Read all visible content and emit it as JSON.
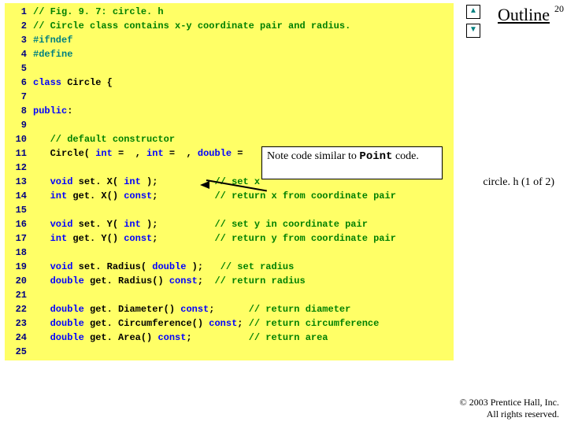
{
  "outline_label": "Outline",
  "page_number": "20",
  "scroll_up_glyph": "▲",
  "scroll_down_glyph": "▼",
  "caption": "circle. h (1 of 2)",
  "callout": {
    "pre": "Note code similar to ",
    "code": "Point",
    "post": " code."
  },
  "copyright": {
    "l1": "© 2003 Prentice Hall, Inc.",
    "l2": "All rights reserved."
  },
  "code": [
    {
      "n": "1",
      "segs": [
        [
          "cmt",
          "// Fig. 9. 7: circle. h"
        ]
      ]
    },
    {
      "n": "2",
      "segs": [
        [
          "cmt",
          "// Circle class contains x-y coordinate pair and radius."
        ]
      ]
    },
    {
      "n": "3",
      "segs": [
        [
          "pre",
          "#ifndef"
        ]
      ]
    },
    {
      "n": "4",
      "segs": [
        [
          "pre",
          "#define"
        ]
      ]
    },
    {
      "n": "5",
      "segs": []
    },
    {
      "n": "6",
      "segs": [
        [
          "kw",
          "class"
        ],
        [
          "plain",
          " Circle {"
        ]
      ]
    },
    {
      "n": "7",
      "segs": []
    },
    {
      "n": "8",
      "segs": [
        [
          "kw",
          "public"
        ],
        [
          "plain",
          ":"
        ]
      ]
    },
    {
      "n": "9",
      "segs": []
    },
    {
      "n": "10",
      "segs": [
        [
          "plain",
          "   "
        ],
        [
          "cmt",
          "// default constructor"
        ]
      ]
    },
    {
      "n": "11",
      "segs": [
        [
          "plain",
          "   Circle( "
        ],
        [
          "kw",
          "int"
        ],
        [
          "plain",
          " =  , "
        ],
        [
          "kw",
          "int"
        ],
        [
          "plain",
          " =  , "
        ],
        [
          "kw",
          "double"
        ],
        [
          "plain",
          " =     );"
        ]
      ]
    },
    {
      "n": "12",
      "segs": []
    },
    {
      "n": "13",
      "segs": [
        [
          "plain",
          "   "
        ],
        [
          "kw",
          "void"
        ],
        [
          "plain",
          " set. X( "
        ],
        [
          "kw",
          "int"
        ],
        [
          "plain",
          " );          "
        ],
        [
          "cmt",
          "// set x"
        ]
      ]
    },
    {
      "n": "14",
      "segs": [
        [
          "plain",
          "   "
        ],
        [
          "kw",
          "int"
        ],
        [
          "plain",
          " get. X() "
        ],
        [
          "kw",
          "const"
        ],
        [
          "plain",
          ";          "
        ],
        [
          "cmt",
          "// return x from coordinate pair"
        ]
      ]
    },
    {
      "n": "15",
      "segs": []
    },
    {
      "n": "16",
      "segs": [
        [
          "plain",
          "   "
        ],
        [
          "kw",
          "void"
        ],
        [
          "plain",
          " set. Y( "
        ],
        [
          "kw",
          "int"
        ],
        [
          "plain",
          " );          "
        ],
        [
          "cmt",
          "// set y in coordinate pair"
        ]
      ]
    },
    {
      "n": "17",
      "segs": [
        [
          "plain",
          "   "
        ],
        [
          "kw",
          "int"
        ],
        [
          "plain",
          " get. Y() "
        ],
        [
          "kw",
          "const"
        ],
        [
          "plain",
          ";          "
        ],
        [
          "cmt",
          "// return y from coordinate pair"
        ]
      ]
    },
    {
      "n": "18",
      "segs": []
    },
    {
      "n": "19",
      "segs": [
        [
          "plain",
          "   "
        ],
        [
          "kw",
          "void"
        ],
        [
          "plain",
          " set. Radius( "
        ],
        [
          "kw",
          "double"
        ],
        [
          "plain",
          " );   "
        ],
        [
          "cmt",
          "// set radius"
        ]
      ]
    },
    {
      "n": "20",
      "segs": [
        [
          "plain",
          "   "
        ],
        [
          "kw",
          "double"
        ],
        [
          "plain",
          " get. Radius() "
        ],
        [
          "kw",
          "const"
        ],
        [
          "plain",
          ";  "
        ],
        [
          "cmt",
          "// return radius"
        ]
      ]
    },
    {
      "n": "21",
      "segs": []
    },
    {
      "n": "22",
      "segs": [
        [
          "plain",
          "   "
        ],
        [
          "kw",
          "double"
        ],
        [
          "plain",
          " get. Diameter() "
        ],
        [
          "kw",
          "const"
        ],
        [
          "plain",
          ";      "
        ],
        [
          "cmt",
          "// return diameter"
        ]
      ]
    },
    {
      "n": "23",
      "segs": [
        [
          "plain",
          "   "
        ],
        [
          "kw",
          "double"
        ],
        [
          "plain",
          " get. Circumference() "
        ],
        [
          "kw",
          "const"
        ],
        [
          "plain",
          "; "
        ],
        [
          "cmt",
          "// return circumference"
        ]
      ]
    },
    {
      "n": "24",
      "segs": [
        [
          "plain",
          "   "
        ],
        [
          "kw",
          "double"
        ],
        [
          "plain",
          " get. Area() "
        ],
        [
          "kw",
          "const"
        ],
        [
          "plain",
          ";          "
        ],
        [
          "cmt",
          "// return area"
        ]
      ]
    },
    {
      "n": "25",
      "segs": []
    }
  ]
}
